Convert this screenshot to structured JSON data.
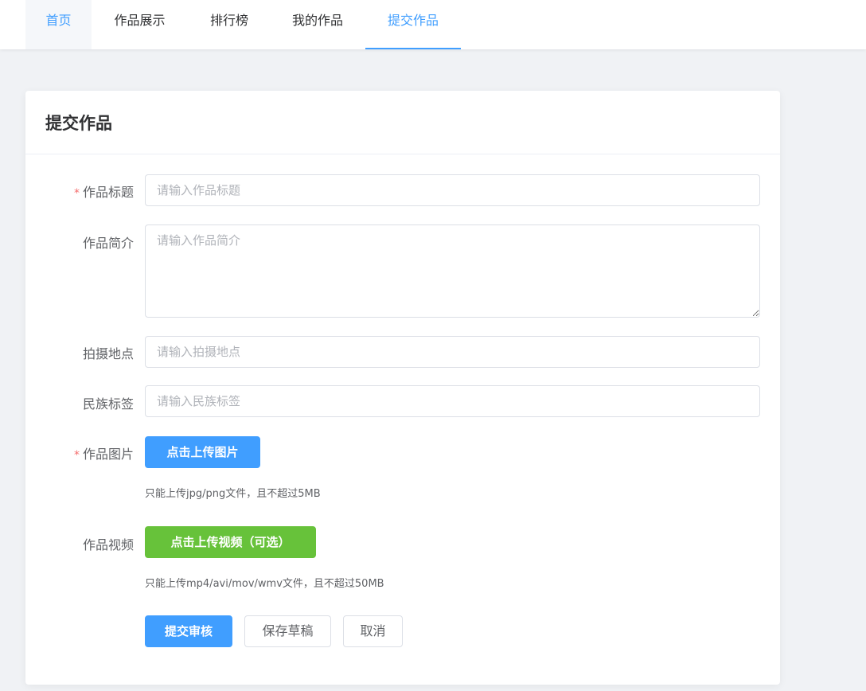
{
  "nav": {
    "items": [
      {
        "label": "首页"
      },
      {
        "label": "作品展示"
      },
      {
        "label": "排行榜"
      },
      {
        "label": "我的作品"
      },
      {
        "label": "提交作品"
      }
    ]
  },
  "card": {
    "title": "提交作品"
  },
  "form": {
    "required_mark": "*",
    "title": {
      "label": "作品标题",
      "placeholder": "请输入作品标题",
      "value": ""
    },
    "intro": {
      "label": "作品简介",
      "placeholder": "请输入作品简介",
      "value": ""
    },
    "location": {
      "label": "拍摄地点",
      "placeholder": "请输入拍摄地点",
      "value": ""
    },
    "ethnic_tag": {
      "label": "民族标签",
      "placeholder": "请输入民族标签",
      "value": ""
    },
    "image": {
      "label": "作品图片",
      "button": "点击上传图片",
      "tip": "只能上传jpg/png文件，且不超过5MB"
    },
    "video": {
      "label": "作品视频",
      "button": "点击上传视频（可选）",
      "tip": "只能上传mp4/avi/mov/wmv文件，且不超过50MB"
    }
  },
  "actions": {
    "submit": "提交审核",
    "save_draft": "保存草稿",
    "cancel": "取消"
  },
  "colors": {
    "primary": "#409eff",
    "success": "#67c23a",
    "required": "#f56c6c"
  }
}
